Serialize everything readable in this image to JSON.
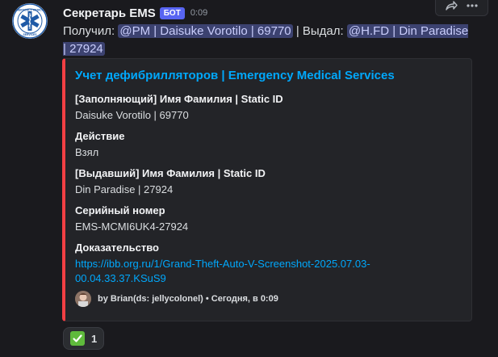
{
  "message": {
    "author": "Секретарь EMS",
    "bot_tag": "БОТ",
    "time": "0:09",
    "line_received": "Получил:",
    "mention_received": "@PM | Daisuke Vorotilo | 69770",
    "line_issued": "| Выдал:",
    "mention_issued": "@H.FD | Din Paradise | 27924"
  },
  "avatar": {
    "top_text": "EMERGENCY MEDICAL",
    "bottom_text": "SERVICES"
  },
  "embed": {
    "color": "#f23f43",
    "title": "Учет дефибрилляторов | Emergency Medical Services",
    "fields": [
      {
        "name": "[Заполняющий] Имя Фамилия | Static ID",
        "value": "Daisuke Vorotilo | 69770"
      },
      {
        "name": "Действие",
        "value": "Взял"
      },
      {
        "name": "[Выдавший] Имя Фамилия | Static ID",
        "value": "Din Paradise | 27924"
      },
      {
        "name": "Серийный номер",
        "value": "EMS-MCMI6UK4-27924"
      },
      {
        "name": "Доказательство",
        "value": "https://ibb.org.ru/1/Grand-Theft-Auto-V-Screenshot-2025.07.03-00.04.33.37.KSuS9"
      }
    ],
    "footer": "by Brian(ds: jellycolonel) • Сегодня, в 0:09"
  },
  "reaction": {
    "emoji": "check-mark-icon",
    "count": "1"
  },
  "toolbar": {
    "icons": [
      "forward-icon",
      "more-icon"
    ]
  }
}
